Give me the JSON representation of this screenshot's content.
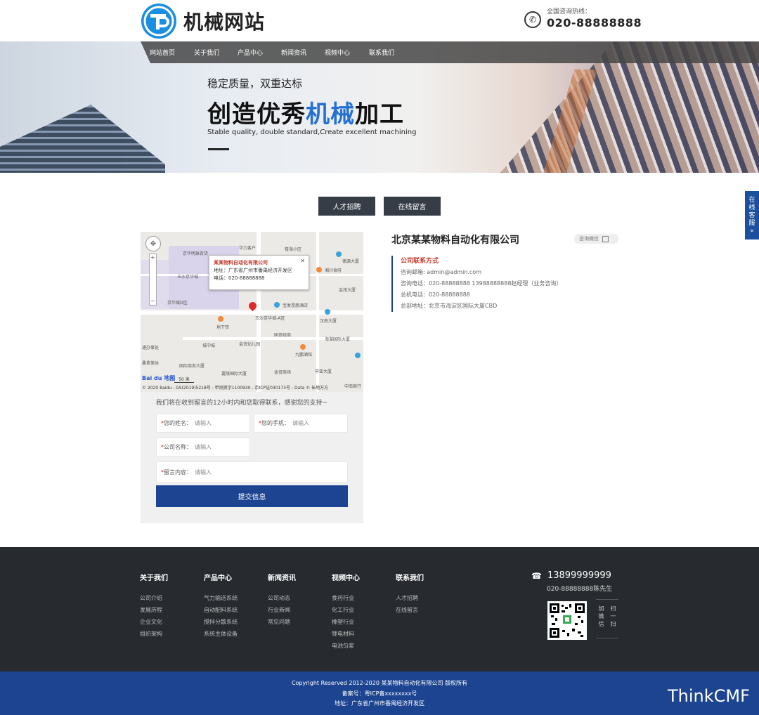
{
  "header": {
    "site_name": "机械网站",
    "hotline_label": "全国咨询热线：",
    "hotline_number": "020-88888888"
  },
  "nav": [
    "网站首页",
    "关于我们",
    "产品中心",
    "新闻资讯",
    "视频中心",
    "联系我们"
  ],
  "banner": {
    "subtitle": "稳定质量，双重达标",
    "title_part1": "创造优秀",
    "title_highlight": "机械",
    "title_part2": "加工",
    "english": "Stable quality, double standard,Create excellent machining"
  },
  "tabs": [
    "人才招聘",
    "在线留言"
  ],
  "side_service": [
    "在",
    "线",
    "客",
    "服",
    "«"
  ],
  "map": {
    "popup_title": "某某物料自动化有限公司",
    "popup_address": "地址：广东省广州市番禺经济开发区",
    "popup_phone": "电话：020-88888888",
    "copyright": "© 2020 Baidu - GS(2019)5218号 - 甲测资字1100930 - 京ICP证030173号 - Data © 长地万方",
    "logo": "Bai du 地图",
    "scale": "50 米",
    "labels": [
      "华力客户",
      "京华明珠百货",
      "楼海小区",
      "德源大厦",
      "湘川食府",
      "玉沙京华城",
      "京华城D区",
      "宝发昆慈酒店",
      "汉南大厦",
      "金茂大厦",
      "地下铁",
      "玉沙京华城-A区",
      "海湛国际大厦",
      "城中城",
      "金贸幼儿园",
      "国贸经商",
      "九鹏酒馆",
      "国际商务大厦",
      "嘉陵国际大厦",
      "金贸商场",
      "申亚大厦",
      "中南商行",
      "桑拿美体",
      "通办事处"
    ]
  },
  "form": {
    "note": "我们将在收到留言的12小时内和您取得联系，感谢您的支持~",
    "name_label": "您的姓名：",
    "mobile_label": "您的手机：",
    "company_label": "公司名称：",
    "message_label": "留言内容：",
    "placeholder": "请输入",
    "required_mark": "*",
    "submit_label": "提交信息"
  },
  "company": {
    "name": "北京某某物料自动化有限公司",
    "wechat_label": "咨询微信",
    "info_title": "公司联系方式",
    "email": "咨询邮箱: admin@admin.com",
    "consult_phone": "咨询电话：020-88888888 13988888888赵经理（业务咨询）",
    "main_phone": "总机电话：020-88888888",
    "address": "总部地址：北京市海淀区国际大厦CBD"
  },
  "footer": {
    "columns": [
      {
        "title": "关于我们",
        "items": [
          "公司介绍",
          "发展历程",
          "企业文化",
          "组织架构"
        ]
      },
      {
        "title": "产品中心",
        "items": [
          "气力输送系统",
          "自动配料系统",
          "搅拌分散系统",
          "系统主体设备"
        ]
      },
      {
        "title": "新闻资讯",
        "items": [
          "公司动态",
          "行业新闻",
          "常见问题"
        ]
      },
      {
        "title": "视频中心",
        "items": [
          "食药行业",
          "化工行业",
          "橡塑行业",
          "锂电材料",
          "电池匀浆"
        ]
      },
      {
        "title": "联系我们",
        "items": [
          "人才招聘",
          "在线留言"
        ]
      }
    ],
    "phone": "13899999999",
    "phone_sub": "020-88888888陈先生",
    "scan_col1": [
      "加",
      "微",
      "信"
    ],
    "scan_col2": [
      "扫",
      "一",
      "扫"
    ]
  },
  "bottom": {
    "copyright": "Copyright Reserved 2012-2020 某某物料自动化有限公司 版权所有",
    "icp": "备案号：粤ICP备xxxxxxxx号",
    "address": "地址：广东省广州市番禺经济开发区"
  },
  "watermark": "ThinkCMF",
  "colors": {
    "brand_blue": "#1c4491",
    "logo_blue": "#1a8ee0",
    "accent_red": "#c0392b",
    "footer_bg": "#272b30"
  }
}
